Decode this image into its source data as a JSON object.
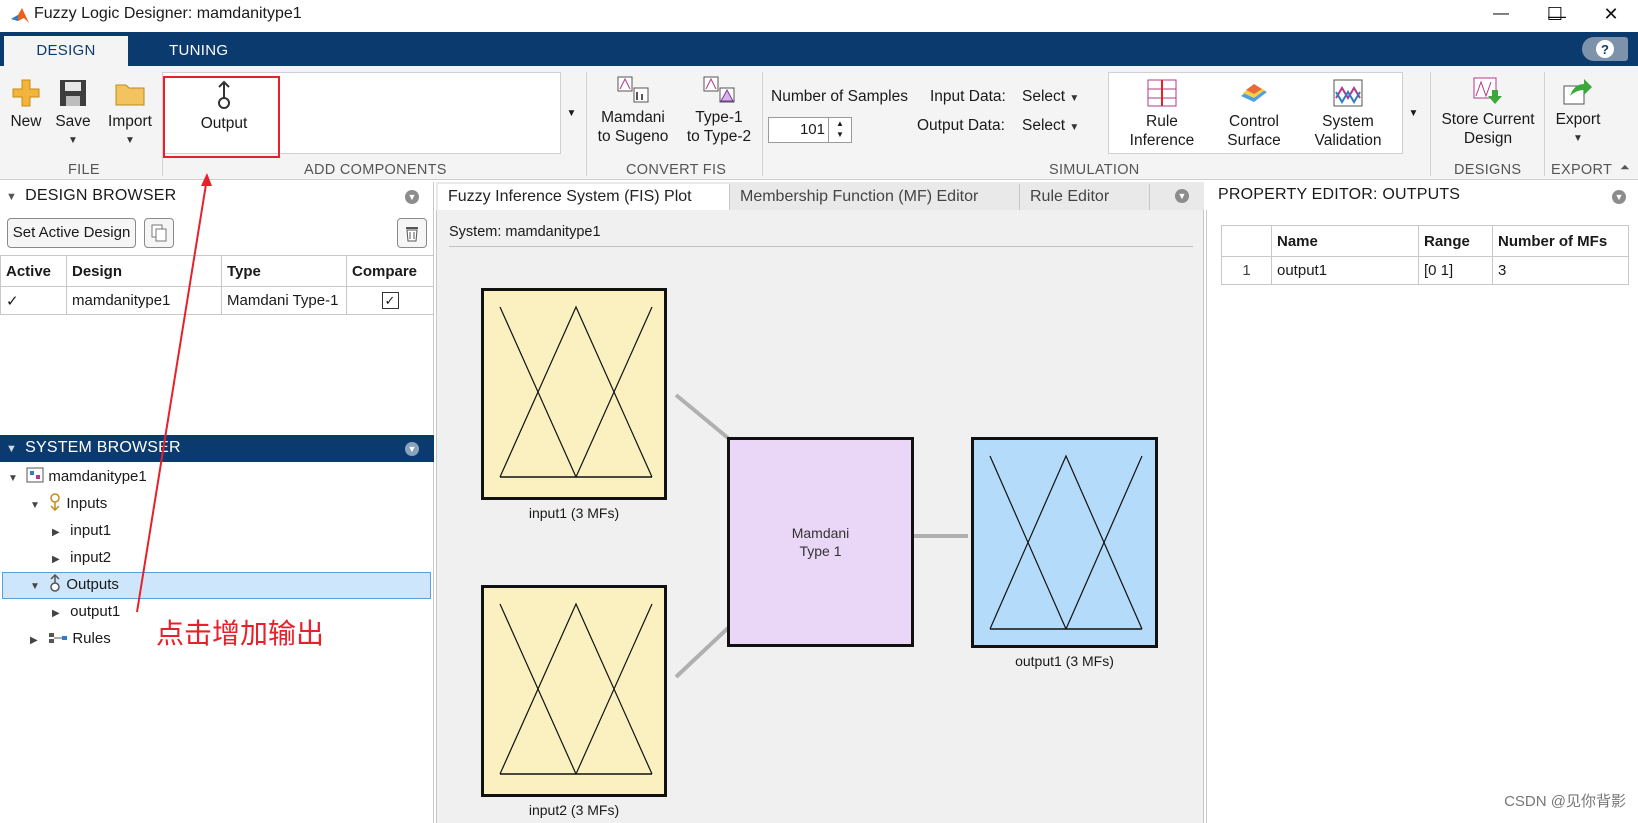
{
  "window": {
    "title": "Fuzzy Logic Designer: mamdanitype1",
    "minimize": "—",
    "maximize": "☐",
    "close": "✕"
  },
  "tabs": [
    {
      "label": "DESIGN",
      "active": true
    },
    {
      "label": "TUNING",
      "active": false
    }
  ],
  "help_label": "?",
  "ribbon": {
    "file": {
      "label": "FILE",
      "new_label": "New",
      "save_label": "Save",
      "import_label": "Import"
    },
    "add_components": {
      "label": "ADD COMPONENTS",
      "output_label": "Output"
    },
    "convert_fis": {
      "label": "CONVERT FIS",
      "mamdani_to_sugeno": [
        "Mamdani",
        "to Sugeno"
      ],
      "type1_to_type2": [
        "Type-1",
        "to Type-2"
      ]
    },
    "simulation": {
      "label": "SIMULATION",
      "number_of_samples_label": "Number of Samples",
      "number_of_samples_value": "101",
      "input_data_label": "Input Data:",
      "input_data_value": "Select",
      "output_data_label": "Output Data:",
      "output_data_value": "Select",
      "rule_inference": [
        "Rule",
        "Inference"
      ],
      "control_surface": [
        "Control",
        "Surface"
      ],
      "system_validation": [
        "System",
        "Validation"
      ]
    },
    "designs": {
      "label": "DESIGNS",
      "store_current_design": [
        "Store Current",
        "Design"
      ]
    },
    "export": {
      "label": "EXPORT",
      "export_label": "Export"
    }
  },
  "design_browser": {
    "title": "DESIGN BROWSER",
    "set_active_design_label": "Set Active Design",
    "columns": [
      "Active",
      "Design",
      "Type",
      "Compare"
    ],
    "rows": [
      {
        "active": "✓",
        "design": "mamdanitype1",
        "type": "Mamdani Type-1",
        "compare": "✓"
      }
    ]
  },
  "system_browser": {
    "title": "SYSTEM BROWSER",
    "tree": {
      "root": "mamdanitype1",
      "inputs": "Inputs",
      "input1": "input1",
      "input2": "input2",
      "outputs": "Outputs",
      "output1": "output1",
      "rules": "Rules"
    }
  },
  "center": {
    "tabs": [
      "Fuzzy Inference System (FIS) Plot",
      "Membership Function (MF) Editor",
      "Rule Editor"
    ],
    "system_label": "System: mamdanitype1",
    "input1_caption": "input1 (3 MFs)",
    "input2_caption": "input2 (3 MFs)",
    "fis_line1": "Mamdani",
    "fis_line2": "Type 1",
    "output1_caption": "output1 (3 MFs)",
    "colors": {
      "input_fill": "#fbf1c0",
      "fis_fill": "#ead6f7",
      "output_fill": "#b4dcfa",
      "connector": "#b0b0b0"
    }
  },
  "property_editor": {
    "title": "PROPERTY EDITOR: OUTPUTS",
    "columns": [
      "",
      "Name",
      "Range",
      "Number of MFs"
    ],
    "rows": [
      {
        "index": "1",
        "name": "output1",
        "range": "[0 1]",
        "num_mfs": "3"
      }
    ]
  },
  "annotation": "点击增加输出",
  "watermark": "CSDN @见你背影",
  "colors": {
    "ribbon_tab_bg": "#0b3b6e",
    "annotation_red": "#e8202a",
    "selection_bg": "#cde6fb"
  }
}
